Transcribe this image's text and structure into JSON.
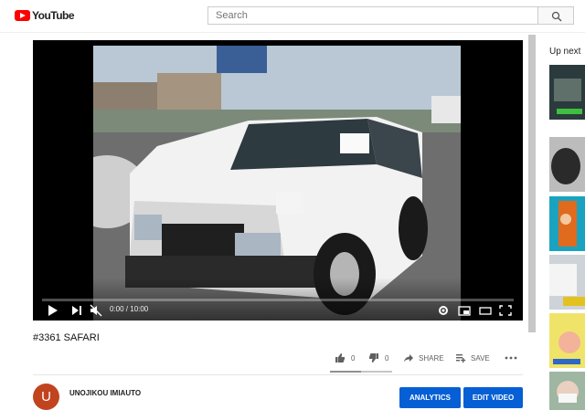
{
  "header": {
    "logo_text": "YouTube",
    "search_placeholder": "Search"
  },
  "player": {
    "time": "0:00 / 10:00",
    "progress": 0
  },
  "video": {
    "title": "#3361 SAFARI",
    "likes": "0",
    "dislikes": "0",
    "share_label": "SHARE",
    "save_label": "SAVE"
  },
  "channel": {
    "name": "UNOJIKOU IMIAUTO",
    "avatar_letter": "U"
  },
  "buttons": {
    "analytics": "ANALYTICS",
    "edit_video": "EDIT VIDEO"
  },
  "sidebar": {
    "up_next_label": "Up next"
  },
  "colors": {
    "brand_red": "#ff0000",
    "primary_blue": "#065fd4",
    "avatar_bg": "#c1441f"
  }
}
